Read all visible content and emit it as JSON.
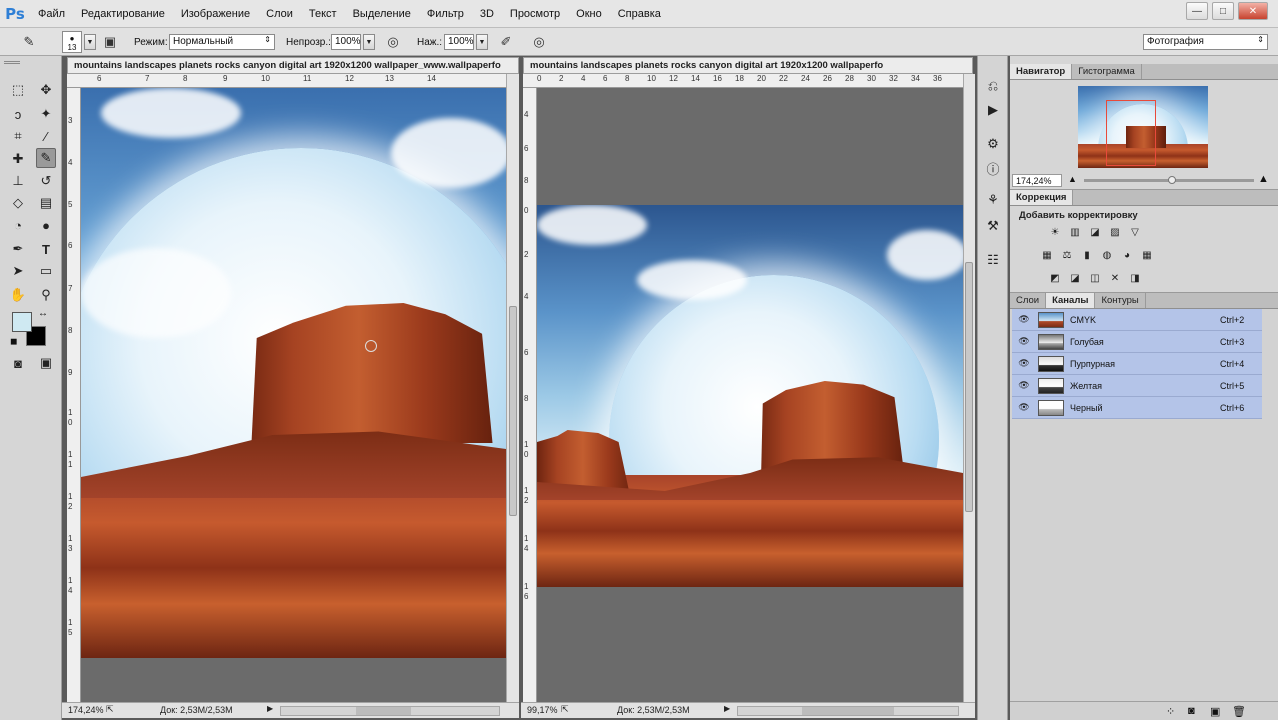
{
  "app": {
    "logo": "Ps"
  },
  "menu": [
    "Файл",
    "Редактирование",
    "Изображение",
    "Слои",
    "Текст",
    "Выделение",
    "Фильтр",
    "3D",
    "Просмотр",
    "Окно",
    "Справка"
  ],
  "window_controls": {
    "minimize": "—",
    "maximize": "□",
    "close": "✕"
  },
  "options": {
    "brush_size": "13",
    "mode_label": "Режим:",
    "mode_value": "Нормальный",
    "opacity_label": "Непрозр.:",
    "opacity_value": "100%",
    "flow_label": "Наж.:",
    "flow_value": "100%",
    "workspace": "Фотография"
  },
  "documents": [
    {
      "title": "mountains landscapes planets rocks canyon digital art 1920x1200 wallpaper_www.wallpaperfo",
      "zoom": "174,24%",
      "doc_info": "Док: 2,53M/2,53M",
      "ruler_h": [
        "6",
        "7",
        "8",
        "9",
        "10",
        "11",
        "12",
        "13",
        "14"
      ],
      "ruler_v": [
        "3",
        "4",
        "5",
        "6",
        "7",
        "8",
        "9",
        "1",
        "0",
        "1",
        "1",
        "1",
        "2",
        "1",
        "3",
        "1",
        "4",
        "1",
        "5"
      ]
    },
    {
      "title": "mountains landscapes planets rocks canyon digital art 1920x1200 wallpaperfo",
      "zoom": "99,17%",
      "doc_info": "Док: 2,53M/2,53M",
      "ruler_h": [
        "0",
        "2",
        "4",
        "6",
        "8",
        "10",
        "12",
        "14",
        "16",
        "18",
        "20",
        "22",
        "24",
        "26",
        "28",
        "30",
        "32",
        "34",
        "36"
      ],
      "ruler_v": [
        "4",
        "6",
        "8",
        "0",
        "2",
        "4",
        "6",
        "8",
        "1",
        "0",
        "1",
        "2",
        "1",
        "4",
        "1",
        "6"
      ]
    }
  ],
  "navigator": {
    "tabs": [
      "Навигатор",
      "Гистограмма"
    ],
    "zoom": "174,24%"
  },
  "correction": {
    "tab": "Коррекция",
    "heading": "Добавить корректировку",
    "row1": [
      "☀",
      "▥",
      "◪",
      "▨",
      "▽"
    ],
    "row2": [
      "▦",
      "⚖",
      "▮",
      "◍",
      "◕",
      "▦"
    ],
    "row3": [
      "◩",
      "◪",
      "◫",
      "✕",
      "◨"
    ]
  },
  "layers": {
    "tabs": [
      "Слои",
      "Каналы",
      "Контуры"
    ],
    "channels": [
      {
        "name": "CMYK",
        "key": "Ctrl+2"
      },
      {
        "name": "Голубая",
        "key": "Ctrl+3"
      },
      {
        "name": "Пурпурная",
        "key": "Ctrl+4"
      },
      {
        "name": "Желтая",
        "key": "Ctrl+5"
      },
      {
        "name": "Черный",
        "key": "Ctrl+6"
      }
    ]
  },
  "colors": {
    "foreground": "#cfe9f2",
    "background": "#000000",
    "selected_row": "#b4c4e8"
  }
}
